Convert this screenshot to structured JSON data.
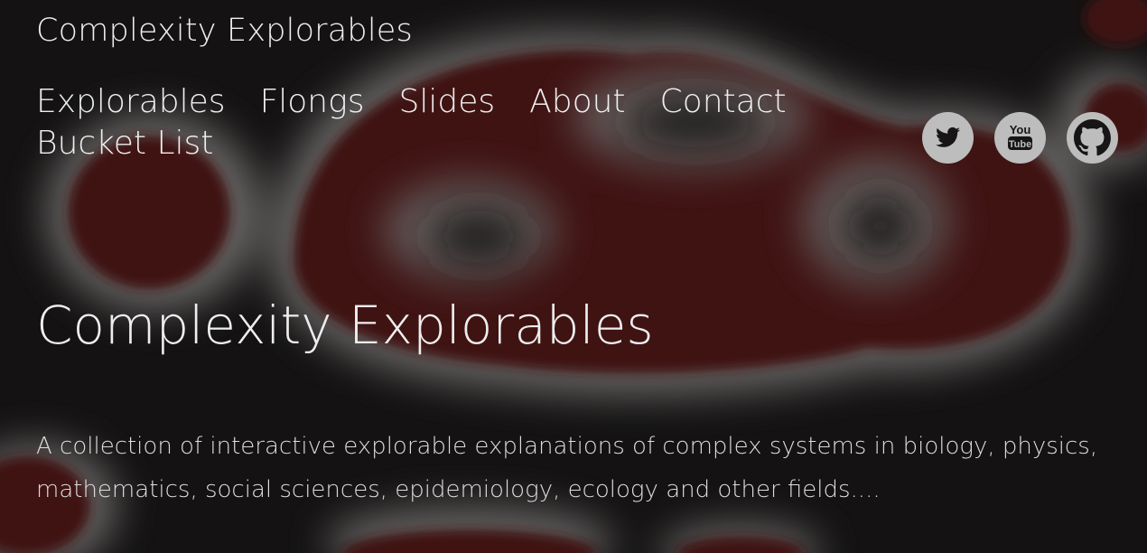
{
  "site": {
    "title": "Complexity Explorables"
  },
  "nav": {
    "items": [
      "Explorables",
      "Flongs",
      "Slides",
      "About",
      "Contact",
      "Bucket List"
    ]
  },
  "social": {
    "icons": [
      "twitter-icon",
      "youtube-icon",
      "github-icon"
    ],
    "youtube_top": "You",
    "youtube_bottom": "Tube"
  },
  "main": {
    "title": "Complexity Explorables",
    "description": "A collection of interactive explorable explanations of complex systems in biology, physics, mathematics, social sciences, epidemiology, ecology and other fields...."
  },
  "colors": {
    "background": "#171515",
    "blob": "#4a1612",
    "halo": "#7f7d7c",
    "icon": "#bdbdbd",
    "text": "#eeeeee"
  }
}
